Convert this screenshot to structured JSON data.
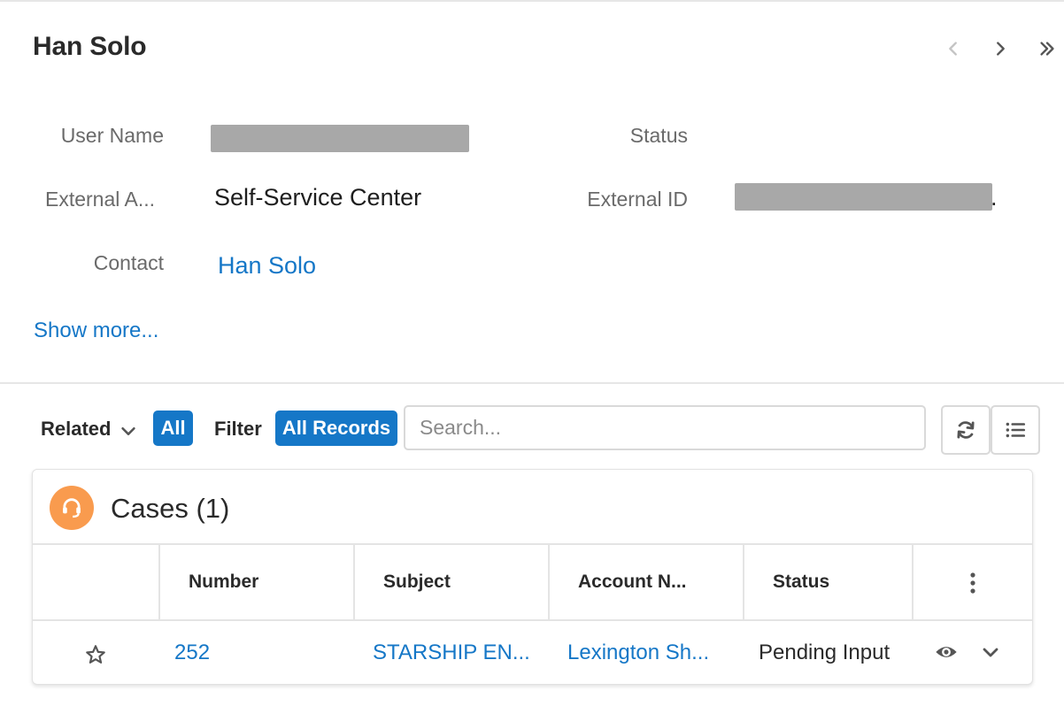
{
  "record": {
    "title": "Han Solo"
  },
  "details": {
    "user_name_label": "User Name",
    "status_label": "Status",
    "external_app_label": "External A...",
    "external_app_value": "Self-Service Center",
    "external_id_label": "External ID",
    "external_id_trailing": ".",
    "contact_label": "Contact",
    "contact_value": "Han Solo",
    "show_more": "Show more..."
  },
  "toolbar": {
    "related_label": "Related",
    "related_pill": "All",
    "filter_label": "Filter",
    "filter_pill": "All Records",
    "search_placeholder": "Search..."
  },
  "cases": {
    "title": "Cases (1)",
    "icon": "case-headset-icon",
    "accent_color": "#f99b4e",
    "columns": [
      "Number",
      "Subject",
      "Account N...",
      "Status"
    ],
    "rows": [
      {
        "number": "252",
        "subject": "STARSHIP EN...",
        "account": "Lexington Sh...",
        "status": "Pending Input"
      }
    ]
  },
  "colors": {
    "link": "#1577c7",
    "pill_bg": "#1577c7"
  }
}
